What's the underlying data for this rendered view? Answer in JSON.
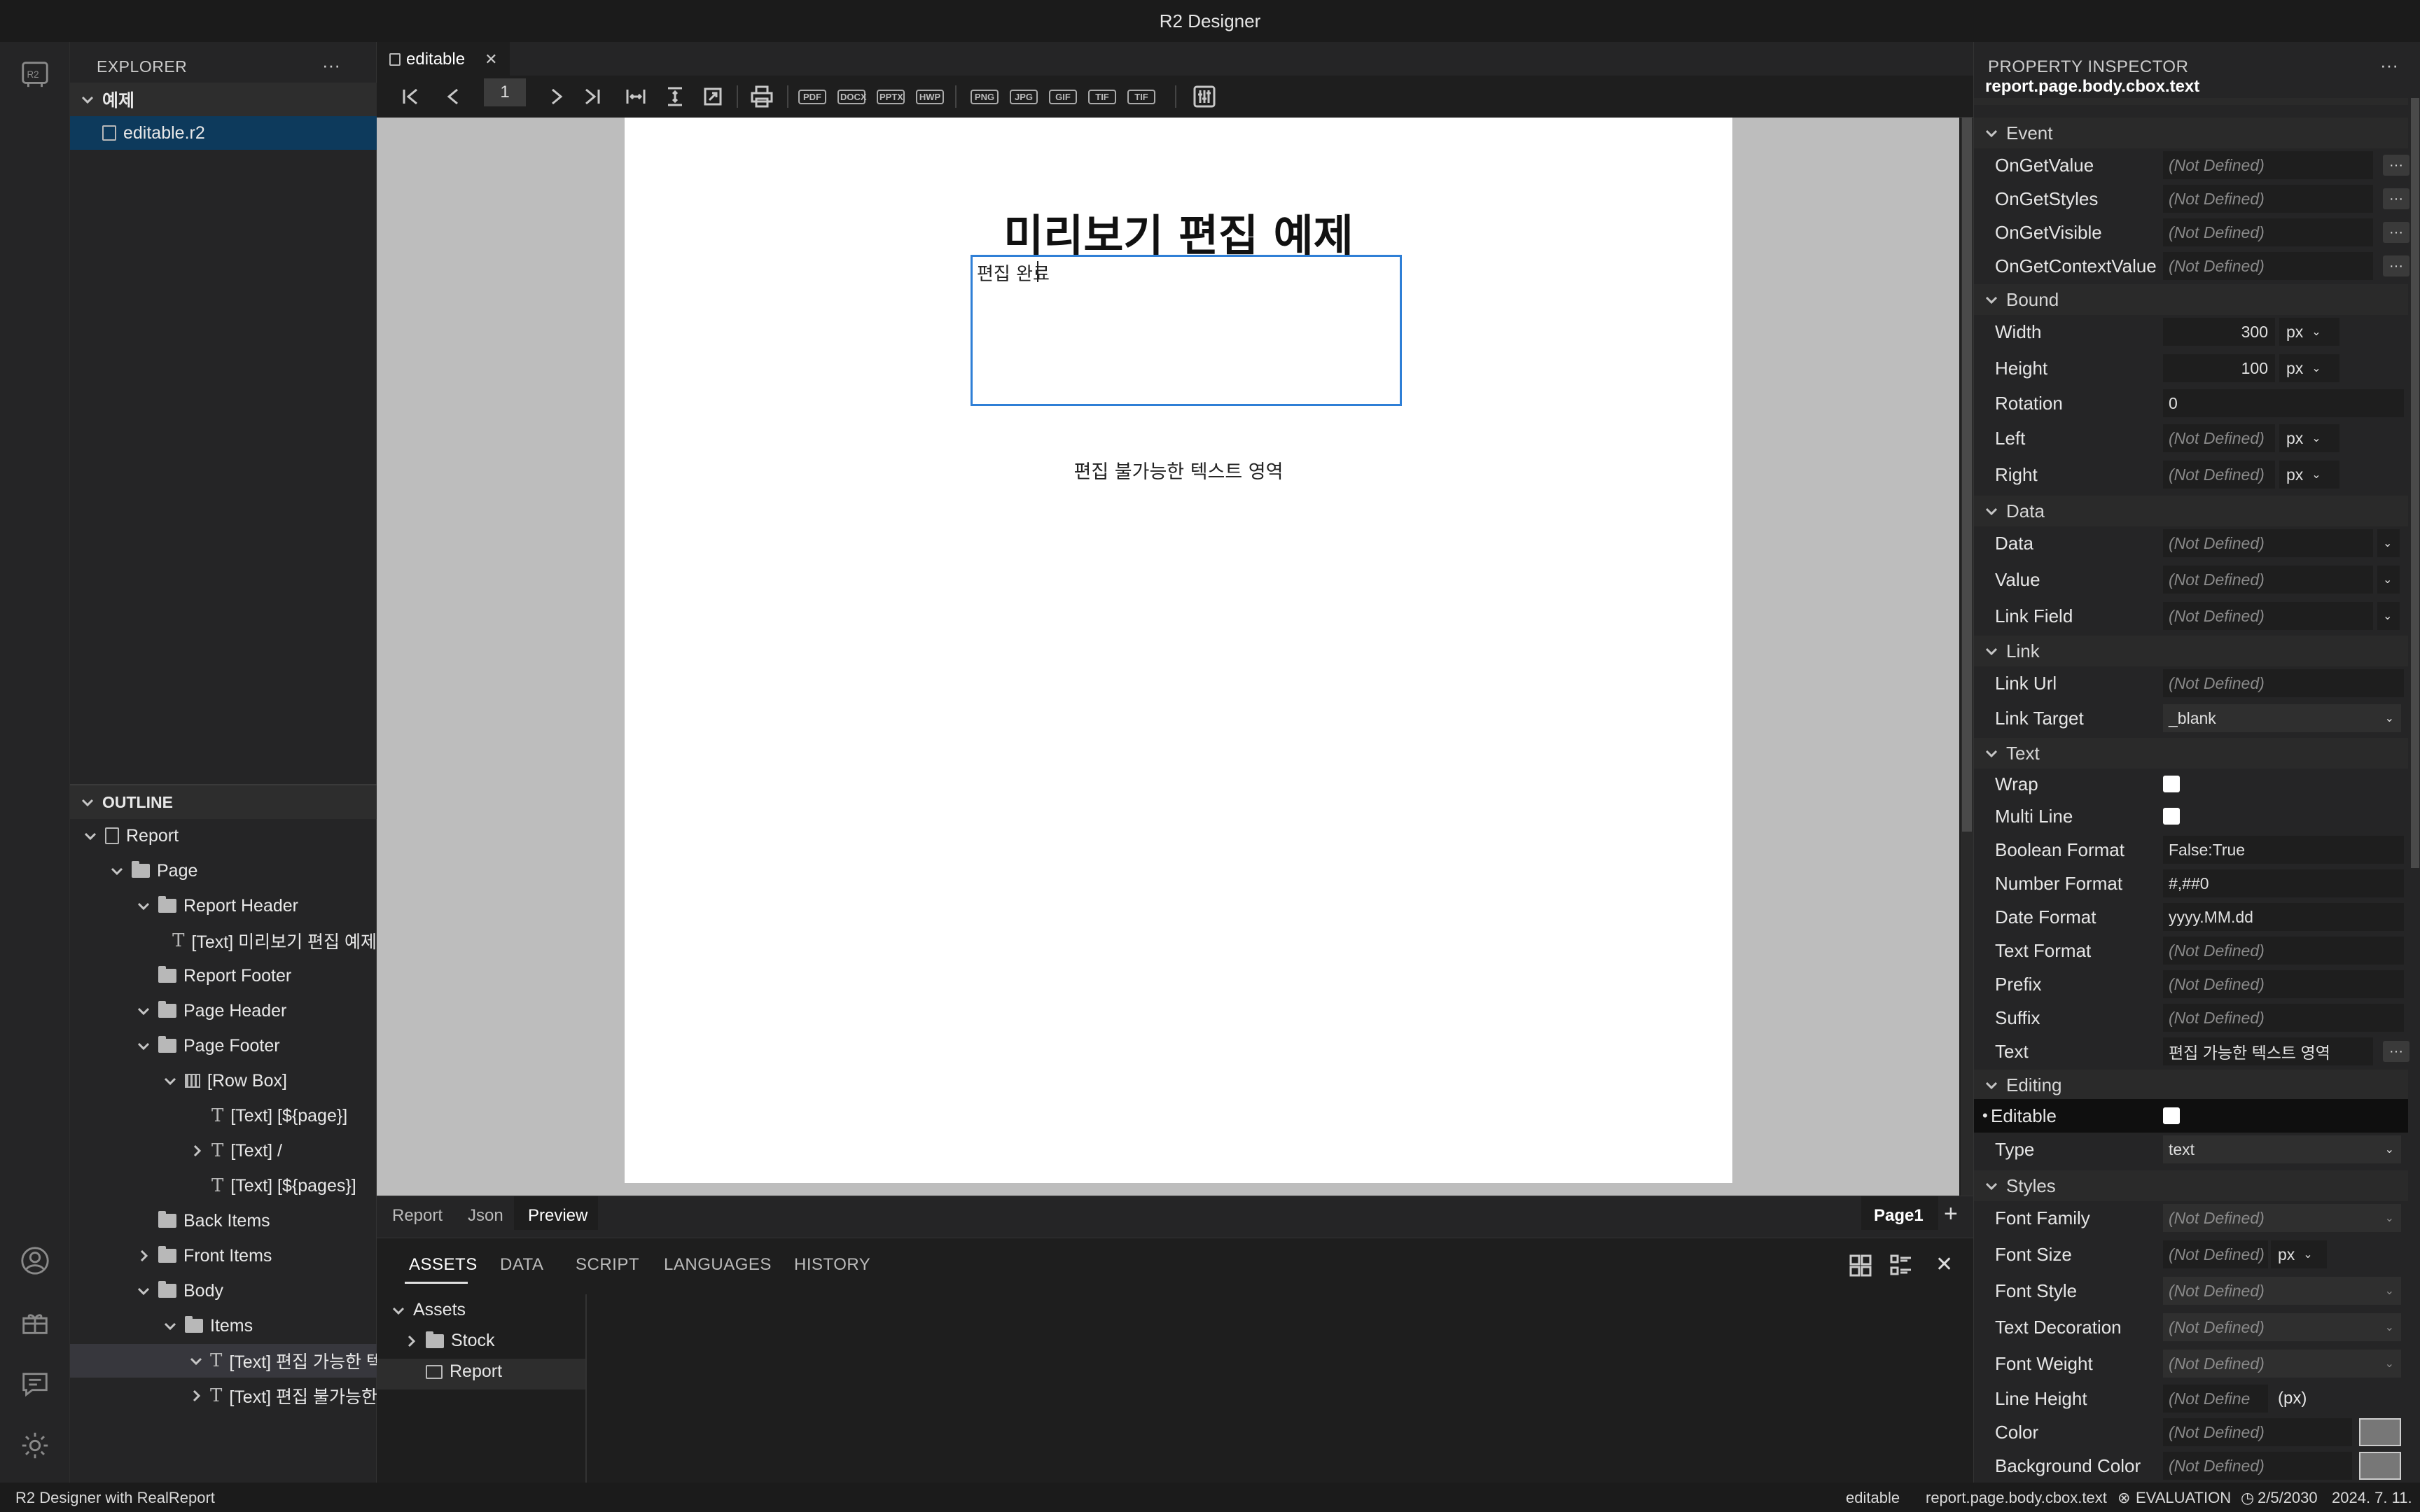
{
  "window": {
    "title": "R2 Designer"
  },
  "explorer": {
    "title": "EXPLORER",
    "more": "···",
    "folder": "예제",
    "file": "editable.r2",
    "outline_title": "OUTLINE"
  },
  "outline": [
    {
      "label": "Report",
      "indent": 0,
      "chev": "down",
      "icon": "doc"
    },
    {
      "label": "Page",
      "indent": 1,
      "chev": "down",
      "icon": "folder"
    },
    {
      "label": "Report Header",
      "indent": 2,
      "chev": "down",
      "icon": "folder"
    },
    {
      "label": "[Text] 미리보기 편집 예제",
      "indent": 3,
      "chev": "none",
      "icon": "text"
    },
    {
      "label": "Report Footer",
      "indent": 2,
      "chev": "none",
      "icon": "folder"
    },
    {
      "label": "Page Header",
      "indent": 2,
      "chev": "down",
      "icon": "folder"
    },
    {
      "label": "Page Footer",
      "indent": 2,
      "chev": "down",
      "icon": "folder"
    },
    {
      "label": "[Row Box]",
      "indent": 3,
      "chev": "down",
      "icon": "rowbox"
    },
    {
      "label": "[Text] [${page}]",
      "indent": 4,
      "chev": "none",
      "icon": "text"
    },
    {
      "label": "[Text] /",
      "indent": 4,
      "chev": "right",
      "icon": "text"
    },
    {
      "label": "[Text] [${pages}]",
      "indent": 4,
      "chev": "none",
      "icon": "text"
    },
    {
      "label": "Back Items",
      "indent": 2,
      "chev": "none",
      "icon": "folder"
    },
    {
      "label": "Front Items",
      "indent": 2,
      "chev": "right",
      "icon": "folder"
    },
    {
      "label": "Body",
      "indent": 2,
      "chev": "down",
      "icon": "folder"
    },
    {
      "label": "Items",
      "indent": 3,
      "chev": "down",
      "icon": "folder"
    },
    {
      "label": "[Text] 편집 가능한 텍스...",
      "indent": 4,
      "chev": "down",
      "icon": "text",
      "selected": true
    },
    {
      "label": "[Text] 편집 불가능한 텍...",
      "indent": 4,
      "chev": "right",
      "icon": "text"
    }
  ],
  "editor": {
    "tab_label": "editable",
    "page_number": "1",
    "formats": [
      "PDF",
      "DOCX",
      "PPTX",
      "HWP",
      "PNG",
      "JPG",
      "GIF",
      "TIF",
      "TIF"
    ],
    "report_title": "미리보기 편집 예제",
    "editable_text": "편집 완료",
    "static_text": "편집 불가능한 텍스트 영역",
    "bottom_tabs": [
      "Report",
      "Json",
      "Preview"
    ],
    "page_tab": "Page1",
    "add": "+"
  },
  "panel": {
    "tabs": [
      "ASSETS",
      "DATA",
      "SCRIPT",
      "LANGUAGES",
      "HISTORY"
    ],
    "close": "✕",
    "root": "Assets",
    "items": [
      "Stock",
      "Report"
    ]
  },
  "inspector": {
    "title": "PROPERTY INSPECTOR",
    "more": "···",
    "path": "report.page.body.cbox.text",
    "not_defined": "(Not Defined)",
    "groups": {
      "event": "Event",
      "bound": "Bound",
      "data": "Data",
      "link": "Link",
      "text": "Text",
      "editing": "Editing",
      "styles": "Styles"
    },
    "event": [
      "OnGetValue",
      "OnGetStyles",
      "OnGetVisible",
      "OnGetContextValue"
    ],
    "bound": {
      "width_label": "Width",
      "width": "300",
      "height_label": "Height",
      "height": "100",
      "rotation_label": "Rotation",
      "rotation": "0",
      "left_label": "Left",
      "right_label": "Right",
      "unit": "px"
    },
    "data": [
      "Data",
      "Value",
      "Link Field"
    ],
    "link": {
      "url_label": "Link Url",
      "target_label": "Link Target",
      "target": "_blank"
    },
    "text": {
      "wrap": "Wrap",
      "multiline": "Multi Line",
      "bool_label": "Boolean Format",
      "bool": "False:True",
      "num_label": "Number Format",
      "num": "#,##0",
      "date_label": "Date Format",
      "date": "yyyy.MM.dd",
      "textfmt_label": "Text Format",
      "prefix_label": "Prefix",
      "suffix_label": "Suffix",
      "text_label": "Text",
      "text": "편집 가능한 텍스트 영역"
    },
    "editing": {
      "editable_label": "Editable",
      "type_label": "Type",
      "type": "text"
    },
    "styles": {
      "font_family": "Font Family",
      "font_size": "Font Size",
      "font_style": "Font Style",
      "text_decoration": "Text Decoration",
      "font_weight": "Font Weight",
      "line_height": "Line Height",
      "line_height_val": "(Not Define",
      "line_height_unit": "(px)",
      "color": "Color",
      "bg_color": "Background Color"
    }
  },
  "status": {
    "left": "R2 Designer with RealReport",
    "file": "editable",
    "path": "report.page.body.cbox.text",
    "license": "EVALUATION",
    "expiry": "2/5/2030",
    "date": "2024. 7. 11."
  }
}
